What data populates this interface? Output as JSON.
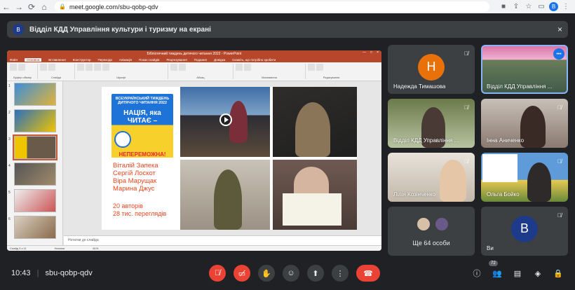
{
  "browser": {
    "url": "meet.google.com/sbu-qobp-qdv",
    "profile_initial": "B"
  },
  "banner": {
    "avatar_initial": "B",
    "text": "Відділ КДД Управління культури і туризму на екрані"
  },
  "ppt": {
    "window_title": "Бібліотечний тиждень дитячого читання 2022 - PowerPoint",
    "menu": [
      "Файл",
      "Основна",
      "Вставлення",
      "Конструктор",
      "Переходи",
      "Анімація",
      "Показ слайдів",
      "Рецензування",
      "Подання",
      "Довідка",
      "Скажіть, що потрібно зробити"
    ],
    "active_menu": "Основна",
    "ribbon_groups": [
      "Буфер обміну",
      "Слайди",
      "Шрифт",
      "Абзац",
      "Малювання",
      "Редагування"
    ],
    "slide_numbers": [
      "1",
      "2",
      "3",
      "4",
      "5",
      "6"
    ],
    "notes_placeholder": "Нотатки до слайда",
    "status_left": "Слайд 3 з 11",
    "status_mid": "Нотатки",
    "status_zoom": "61%"
  },
  "slide": {
    "poster_top": "ВСЕУКРАЇНСЬКИЙ ТИЖДЕНЬ ДИТЯЧОГО ЧИТАННЯ 2022",
    "poster_main": "НАЦІЯ, яка ЧИТАЄ –",
    "poster_bottom": "НЕПЕРЕМОЖНА!",
    "names": [
      "Віталій Запека",
      "Сергій Лоскот",
      "Віра Марущак",
      "Марина Джус"
    ],
    "stats": [
      "20 авторів",
      "28 тис. переглядів"
    ]
  },
  "participants": [
    {
      "name": "Надежда Тимашова",
      "initial": "Н",
      "avatar_color": "#e8710a",
      "muted": true
    },
    {
      "name": "Відділ КДД Управління ...",
      "muted": false,
      "speaking": true
    },
    {
      "name": "Відділ КДД Управління ...",
      "muted": true
    },
    {
      "name": "Інна Аниченко",
      "muted": true
    },
    {
      "name": "Лілія Козінченко",
      "muted": true
    },
    {
      "name": "Ольга Бойко",
      "muted": true
    },
    {
      "name": "Ще 64 особи"
    },
    {
      "name": "Ви",
      "initial": "B",
      "avatar_color": "#1e3a8a",
      "muted": true
    }
  ],
  "controls": {
    "time": "10:43",
    "meeting_code": "sbu-qobp-qdv",
    "people_count": "72"
  },
  "colors": {
    "background": "#202124",
    "tile": "#3c4043",
    "danger": "#ea4335",
    "ppt_accent": "#b7472a",
    "slide_text": "#e8461f"
  }
}
